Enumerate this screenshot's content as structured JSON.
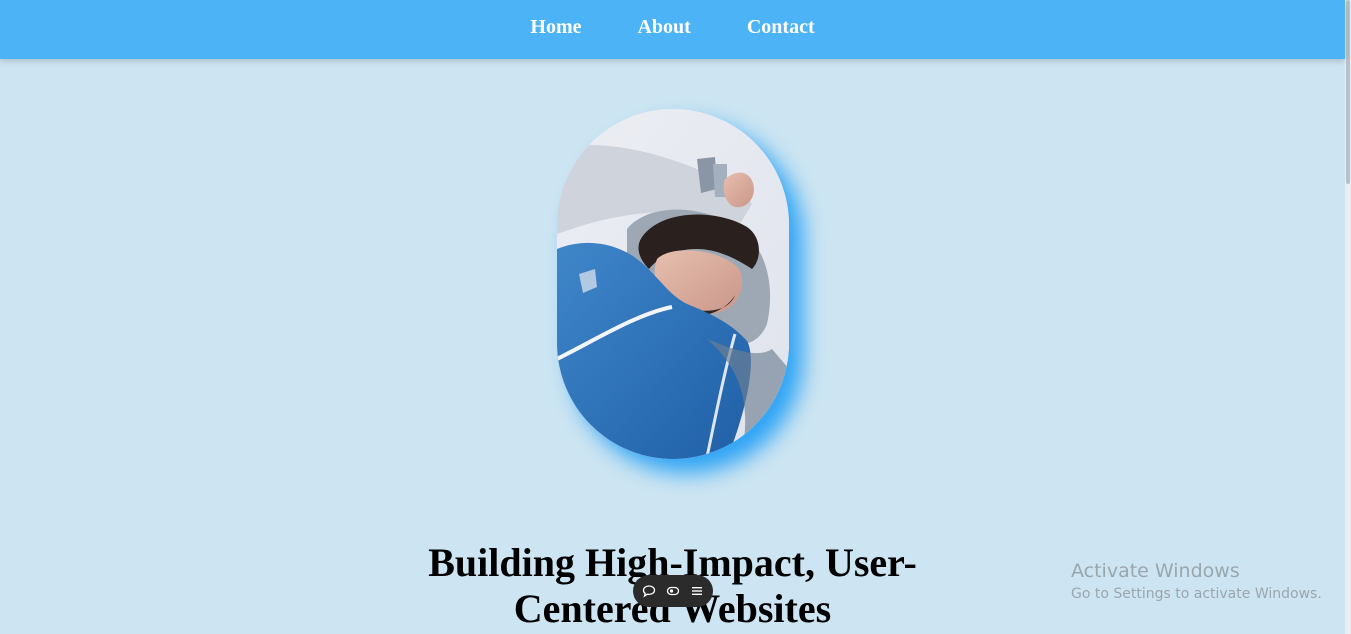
{
  "nav": {
    "items": [
      {
        "label": "Home"
      },
      {
        "label": "About"
      },
      {
        "label": "Contact"
      }
    ]
  },
  "hero": {
    "title": "Building High-Impact, User-Centered Websites"
  },
  "toolbar": {
    "icons": [
      "comment-icon",
      "eye-icon",
      "menu-icon"
    ]
  },
  "watermark": {
    "title": "Activate Windows",
    "subtitle": "Go to Settings to activate Windows."
  },
  "colors": {
    "navbar": "#4db3f7",
    "background": "#cde5f2",
    "photo_glow": "#25a0f5"
  }
}
